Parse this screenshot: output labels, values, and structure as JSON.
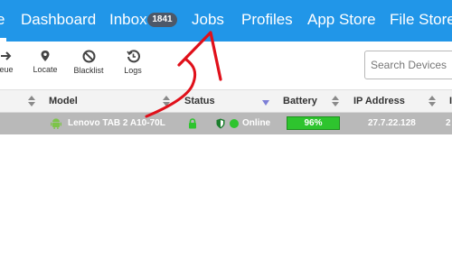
{
  "nav": {
    "items": [
      {
        "label": "e"
      },
      {
        "label": "Dashboard"
      },
      {
        "label": "Inbox"
      },
      {
        "label": "Jobs"
      },
      {
        "label": "Profiles"
      },
      {
        "label": "App Store"
      },
      {
        "label": "File Store"
      }
    ],
    "inbox_badge": "1841"
  },
  "toolbar": {
    "tools": [
      {
        "label": "eue",
        "icon": "queue-arrow-icon"
      },
      {
        "label": "Locate",
        "icon": "location-pin-icon"
      },
      {
        "label": "Blacklist",
        "icon": "blocked-icon"
      },
      {
        "label": "Logs",
        "icon": "history-icon"
      }
    ],
    "search_placeholder": "Search Devices"
  },
  "table": {
    "headers": {
      "model": "Model",
      "status": "Status",
      "battery": "Battery",
      "ip": "IP Address",
      "extra": "I"
    },
    "rows": [
      {
        "model": "Lenovo TAB 2 A10-70L",
        "status": "Online",
        "battery": "96%",
        "ip": "27.7.22.128",
        "extra": "2"
      }
    ]
  },
  "colors": {
    "nav_bg": "#2196e8",
    "badge_bg": "#4d5868",
    "row_bg": "#b9b9b9",
    "online": "#2ec42e",
    "annotation_arrow": "#e0101a"
  }
}
